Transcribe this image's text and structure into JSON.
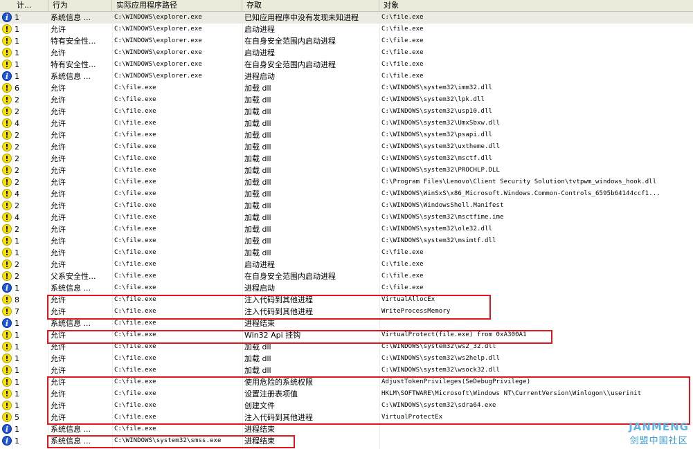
{
  "columns": [
    "计...",
    "行为",
    "实际应用程序路径",
    "存取",
    "对象"
  ],
  "rows": [
    {
      "icon": "info",
      "count": "1",
      "action": "系统信息  ...",
      "path": "C:\\WINDOWS\\explorer.exe",
      "access": "已知应用程序中没有发现未知进程",
      "object": "C:\\file.exe"
    },
    {
      "icon": "warn",
      "count": "1",
      "action": "允许",
      "path": "C:\\WINDOWS\\explorer.exe",
      "access": "启动进程",
      "object": "C:\\file.exe"
    },
    {
      "icon": "warn",
      "count": "1",
      "action": "特有安全性...",
      "path": "C:\\WINDOWS\\explorer.exe",
      "access": "在自身安全范围内启动进程",
      "object": "C:\\file.exe"
    },
    {
      "icon": "warn",
      "count": "1",
      "action": "允许",
      "path": "C:\\WINDOWS\\explorer.exe",
      "access": "启动进程",
      "object": "C:\\file.exe"
    },
    {
      "icon": "warn",
      "count": "1",
      "action": "特有安全性...",
      "path": "C:\\WINDOWS\\explorer.exe",
      "access": "在自身安全范围内启动进程",
      "object": "C:\\file.exe"
    },
    {
      "icon": "info",
      "count": "1",
      "action": "系统信息  ...",
      "path": "C:\\WINDOWS\\explorer.exe",
      "access": "进程启动",
      "object": "C:\\file.exe"
    },
    {
      "icon": "warn",
      "count": "6",
      "action": "允许",
      "path": "C:\\file.exe",
      "access": "加载 dll",
      "object": "C:\\WINDOWS\\system32\\imm32.dll"
    },
    {
      "icon": "warn",
      "count": "2",
      "action": "允许",
      "path": "C:\\file.exe",
      "access": "加载 dll",
      "object": "C:\\WINDOWS\\system32\\lpk.dll"
    },
    {
      "icon": "warn",
      "count": "2",
      "action": "允许",
      "path": "C:\\file.exe",
      "access": "加载 dll",
      "object": "C:\\WINDOWS\\system32\\usp10.dll"
    },
    {
      "icon": "warn",
      "count": "4",
      "action": "允许",
      "path": "C:\\file.exe",
      "access": "加载 dll",
      "object": "C:\\WINDOWS\\system32\\UmxSbxw.dll"
    },
    {
      "icon": "warn",
      "count": "2",
      "action": "允许",
      "path": "C:\\file.exe",
      "access": "加载 dll",
      "object": "C:\\WINDOWS\\system32\\psapi.dll"
    },
    {
      "icon": "warn",
      "count": "2",
      "action": "允许",
      "path": "C:\\file.exe",
      "access": "加载 dll",
      "object": "C:\\WINDOWS\\system32\\uxtheme.dll"
    },
    {
      "icon": "warn",
      "count": "2",
      "action": "允许",
      "path": "C:\\file.exe",
      "access": "加载 dll",
      "object": "C:\\WINDOWS\\system32\\msctf.dll"
    },
    {
      "icon": "warn",
      "count": "2",
      "action": "允许",
      "path": "C:\\file.exe",
      "access": "加载 dll",
      "object": "C:\\WINDOWS\\system32\\PROCHLP.DLL"
    },
    {
      "icon": "warn",
      "count": "2",
      "action": "允许",
      "path": "C:\\file.exe",
      "access": "加载 dll",
      "object": "C:\\Program Files\\Lenovo\\Client Security Solution\\tvtpwm_windows_hook.dll"
    },
    {
      "icon": "warn",
      "count": "4",
      "action": "允许",
      "path": "C:\\file.exe",
      "access": "加载 dll",
      "object": "C:\\WINDOWS\\WinSxS\\x86_Microsoft.Windows.Common-Controls_6595b64144ccf1..."
    },
    {
      "icon": "warn",
      "count": "2",
      "action": "允许",
      "path": "C:\\file.exe",
      "access": "加载 dll",
      "object": "C:\\WINDOWS\\WindowsShell.Manifest"
    },
    {
      "icon": "warn",
      "count": "4",
      "action": "允许",
      "path": "C:\\file.exe",
      "access": "加载 dll",
      "object": "C:\\WINDOWS\\system32\\msctfime.ime"
    },
    {
      "icon": "warn",
      "count": "2",
      "action": "允许",
      "path": "C:\\file.exe",
      "access": "加载 dll",
      "object": "C:\\WINDOWS\\system32\\ole32.dll"
    },
    {
      "icon": "warn",
      "count": "1",
      "action": "允许",
      "path": "C:\\file.exe",
      "access": "加载 dll",
      "object": "C:\\WINDOWS\\system32\\msimtf.dll"
    },
    {
      "icon": "warn",
      "count": "1",
      "action": "允许",
      "path": "C:\\file.exe",
      "access": "加载 dll",
      "object": "C:\\file.exe"
    },
    {
      "icon": "warn",
      "count": "2",
      "action": "允许",
      "path": "C:\\file.exe",
      "access": "启动进程",
      "object": "C:\\file.exe"
    },
    {
      "icon": "warn",
      "count": "2",
      "action": "父系安全性...",
      "path": "C:\\file.exe",
      "access": "在自身安全范围内启动进程",
      "object": "C:\\file.exe"
    },
    {
      "icon": "info",
      "count": "1",
      "action": "系统信息  ...",
      "path": "C:\\file.exe",
      "access": "进程启动",
      "object": "C:\\file.exe"
    },
    {
      "icon": "warn",
      "count": "8",
      "action": "允许",
      "path": "C:\\file.exe",
      "access": "注入代码到其他进程",
      "object": "VirtualAllocEx"
    },
    {
      "icon": "warn",
      "count": "7",
      "action": "允许",
      "path": "C:\\file.exe",
      "access": "注入代码到其他进程",
      "object": "WriteProcessMemory"
    },
    {
      "icon": "info",
      "count": "1",
      "action": "系统信息  ...",
      "path": "C:\\file.exe",
      "access": "进程结束",
      "object": ""
    },
    {
      "icon": "warn",
      "count": "1",
      "action": "允许",
      "path": "C:\\file.exe",
      "access": "Win32 Api 挂钩",
      "object": "VirtualProtect(file.exe) from 0xA300A1"
    },
    {
      "icon": "warn",
      "count": "1",
      "action": "允许",
      "path": "C:\\file.exe",
      "access": "加载 dll",
      "object": "C:\\WINDOWS\\system32\\ws2_32.dll"
    },
    {
      "icon": "warn",
      "count": "1",
      "action": "允许",
      "path": "C:\\file.exe",
      "access": "加载 dll",
      "object": "C:\\WINDOWS\\system32\\ws2help.dll"
    },
    {
      "icon": "warn",
      "count": "1",
      "action": "允许",
      "path": "C:\\file.exe",
      "access": "加载 dll",
      "object": "C:\\WINDOWS\\system32\\wsock32.dll"
    },
    {
      "icon": "warn",
      "count": "1",
      "action": "允许",
      "path": "C:\\file.exe",
      "access": "使用危险的系统权限",
      "object": "AdjustTokenPrivileges(SeDebugPrivilege)"
    },
    {
      "icon": "warn",
      "count": "1",
      "action": "允许",
      "path": "C:\\file.exe",
      "access": "设置注册表项值",
      "object": "HKLM\\SOFTWARE\\Microsoft\\Windows NT\\CurrentVersion\\Winlogon\\\\userinit"
    },
    {
      "icon": "warn",
      "count": "1",
      "action": "允许",
      "path": "C:\\file.exe",
      "access": "创建文件",
      "object": "C:\\WINDOWS\\system32\\sdra64.exe"
    },
    {
      "icon": "warn",
      "count": "5",
      "action": "允许",
      "path": "C:\\file.exe",
      "access": "注入代码到其他进程",
      "object": "VirtualProtectEx"
    },
    {
      "icon": "info",
      "count": "1",
      "action": "系统信息  ...",
      "path": "C:\\file.exe",
      "access": "进程结束",
      "object": ""
    },
    {
      "icon": "info",
      "count": "1",
      "action": "系统信息  ...",
      "path": "C:\\WINDOWS\\system32\\smss.exe",
      "access": "进程结束",
      "object": ""
    }
  ],
  "watermark": {
    "en": "JANMENG",
    "cn": "剑盟中国社区"
  },
  "colors": {
    "highlight": "#e0151d",
    "header_bg": "#ebeadb",
    "selected_row": "#ecebe3",
    "warn_icon": "#f6e400",
    "info_icon": "#1f55d8"
  },
  "icons": {
    "warn": "warning-icon",
    "info": "info-icon"
  }
}
